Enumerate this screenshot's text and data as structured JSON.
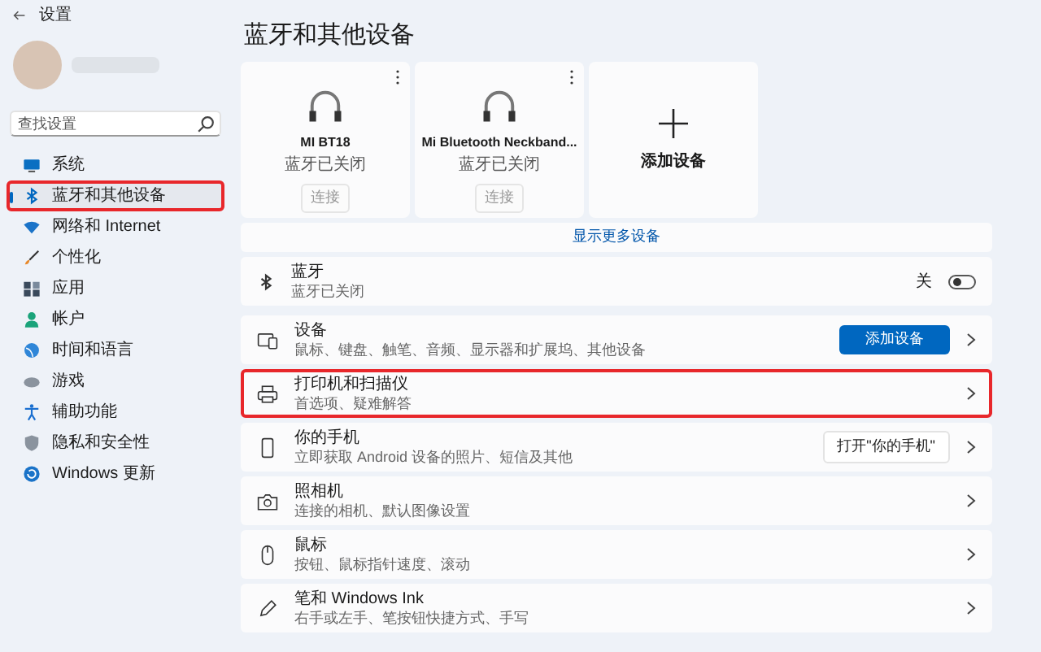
{
  "window": {
    "title": "设置"
  },
  "sidebar": {
    "search": {
      "placeholder": "查找设置"
    },
    "items": [
      {
        "label": "系统",
        "selected": false,
        "highlighted": false
      },
      {
        "label": "蓝牙和其他设备",
        "selected": true,
        "highlighted": true
      },
      {
        "label": "网络和 Internet",
        "selected": false,
        "highlighted": false
      },
      {
        "label": "个性化",
        "selected": false,
        "highlighted": false
      },
      {
        "label": "应用",
        "selected": false,
        "highlighted": false
      },
      {
        "label": "帐户",
        "selected": false,
        "highlighted": false
      },
      {
        "label": "时间和语言",
        "selected": false,
        "highlighted": false
      },
      {
        "label": "游戏",
        "selected": false,
        "highlighted": false
      },
      {
        "label": "辅助功能",
        "selected": false,
        "highlighted": false
      },
      {
        "label": "隐私和安全性",
        "selected": false,
        "highlighted": false
      },
      {
        "label": "Windows 更新",
        "selected": false,
        "highlighted": false
      }
    ]
  },
  "page_title": "蓝牙和其他设备",
  "device_cards": [
    {
      "name": "MI BT18",
      "status": "蓝牙已关闭",
      "button": "连接"
    },
    {
      "name": "Mi Bluetooth Neckband...",
      "status": "蓝牙已关闭",
      "button": "连接"
    }
  ],
  "add_device_card": {
    "label": "添加设备"
  },
  "show_more": "显示更多设备",
  "bluetooth": {
    "title": "蓝牙",
    "subtitle": "蓝牙已关闭",
    "toggle_label": "关",
    "on": false
  },
  "rows": [
    {
      "title": "设备",
      "subtitle": "鼠标、键盘、触笔、音频、显示器和扩展坞、其他设备",
      "action": {
        "kind": "primary",
        "label": "添加设备"
      },
      "highlighted": false
    },
    {
      "title": "打印机和扫描仪",
      "subtitle": "首选项、疑难解答",
      "highlighted": true
    },
    {
      "title": "你的手机",
      "subtitle": "立即获取 Android 设备的照片、短信及其他",
      "action": {
        "kind": "secondary",
        "label": "打开\"你的手机\""
      },
      "highlighted": false
    },
    {
      "title": "照相机",
      "subtitle": "连接的相机、默认图像设置",
      "highlighted": false
    },
    {
      "title": "鼠标",
      "subtitle": "按钮、鼠标指针速度、滚动",
      "highlighted": false
    },
    {
      "title": "笔和 Windows Ink",
      "subtitle": "右手或左手、笔按钮快捷方式、手写",
      "highlighted": false
    }
  ]
}
